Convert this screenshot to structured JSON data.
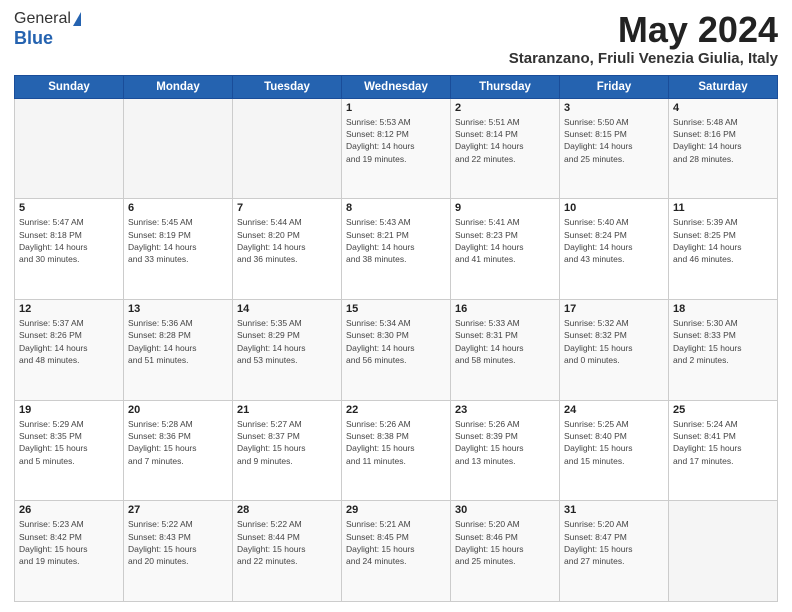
{
  "logo": {
    "general": "General",
    "blue": "Blue"
  },
  "title": "May 2024",
  "location": "Staranzano, Friuli Venezia Giulia, Italy",
  "weekdays": [
    "Sunday",
    "Monday",
    "Tuesday",
    "Wednesday",
    "Thursday",
    "Friday",
    "Saturday"
  ],
  "weeks": [
    [
      {
        "day": "",
        "info": ""
      },
      {
        "day": "",
        "info": ""
      },
      {
        "day": "",
        "info": ""
      },
      {
        "day": "1",
        "info": "Sunrise: 5:53 AM\nSunset: 8:12 PM\nDaylight: 14 hours\nand 19 minutes."
      },
      {
        "day": "2",
        "info": "Sunrise: 5:51 AM\nSunset: 8:14 PM\nDaylight: 14 hours\nand 22 minutes."
      },
      {
        "day": "3",
        "info": "Sunrise: 5:50 AM\nSunset: 8:15 PM\nDaylight: 14 hours\nand 25 minutes."
      },
      {
        "day": "4",
        "info": "Sunrise: 5:48 AM\nSunset: 8:16 PM\nDaylight: 14 hours\nand 28 minutes."
      }
    ],
    [
      {
        "day": "5",
        "info": "Sunrise: 5:47 AM\nSunset: 8:18 PM\nDaylight: 14 hours\nand 30 minutes."
      },
      {
        "day": "6",
        "info": "Sunrise: 5:45 AM\nSunset: 8:19 PM\nDaylight: 14 hours\nand 33 minutes."
      },
      {
        "day": "7",
        "info": "Sunrise: 5:44 AM\nSunset: 8:20 PM\nDaylight: 14 hours\nand 36 minutes."
      },
      {
        "day": "8",
        "info": "Sunrise: 5:43 AM\nSunset: 8:21 PM\nDaylight: 14 hours\nand 38 minutes."
      },
      {
        "day": "9",
        "info": "Sunrise: 5:41 AM\nSunset: 8:23 PM\nDaylight: 14 hours\nand 41 minutes."
      },
      {
        "day": "10",
        "info": "Sunrise: 5:40 AM\nSunset: 8:24 PM\nDaylight: 14 hours\nand 43 minutes."
      },
      {
        "day": "11",
        "info": "Sunrise: 5:39 AM\nSunset: 8:25 PM\nDaylight: 14 hours\nand 46 minutes."
      }
    ],
    [
      {
        "day": "12",
        "info": "Sunrise: 5:37 AM\nSunset: 8:26 PM\nDaylight: 14 hours\nand 48 minutes."
      },
      {
        "day": "13",
        "info": "Sunrise: 5:36 AM\nSunset: 8:28 PM\nDaylight: 14 hours\nand 51 minutes."
      },
      {
        "day": "14",
        "info": "Sunrise: 5:35 AM\nSunset: 8:29 PM\nDaylight: 14 hours\nand 53 minutes."
      },
      {
        "day": "15",
        "info": "Sunrise: 5:34 AM\nSunset: 8:30 PM\nDaylight: 14 hours\nand 56 minutes."
      },
      {
        "day": "16",
        "info": "Sunrise: 5:33 AM\nSunset: 8:31 PM\nDaylight: 14 hours\nand 58 minutes."
      },
      {
        "day": "17",
        "info": "Sunrise: 5:32 AM\nSunset: 8:32 PM\nDaylight: 15 hours\nand 0 minutes."
      },
      {
        "day": "18",
        "info": "Sunrise: 5:30 AM\nSunset: 8:33 PM\nDaylight: 15 hours\nand 2 minutes."
      }
    ],
    [
      {
        "day": "19",
        "info": "Sunrise: 5:29 AM\nSunset: 8:35 PM\nDaylight: 15 hours\nand 5 minutes."
      },
      {
        "day": "20",
        "info": "Sunrise: 5:28 AM\nSunset: 8:36 PM\nDaylight: 15 hours\nand 7 minutes."
      },
      {
        "day": "21",
        "info": "Sunrise: 5:27 AM\nSunset: 8:37 PM\nDaylight: 15 hours\nand 9 minutes."
      },
      {
        "day": "22",
        "info": "Sunrise: 5:26 AM\nSunset: 8:38 PM\nDaylight: 15 hours\nand 11 minutes."
      },
      {
        "day": "23",
        "info": "Sunrise: 5:26 AM\nSunset: 8:39 PM\nDaylight: 15 hours\nand 13 minutes."
      },
      {
        "day": "24",
        "info": "Sunrise: 5:25 AM\nSunset: 8:40 PM\nDaylight: 15 hours\nand 15 minutes."
      },
      {
        "day": "25",
        "info": "Sunrise: 5:24 AM\nSunset: 8:41 PM\nDaylight: 15 hours\nand 17 minutes."
      }
    ],
    [
      {
        "day": "26",
        "info": "Sunrise: 5:23 AM\nSunset: 8:42 PM\nDaylight: 15 hours\nand 19 minutes."
      },
      {
        "day": "27",
        "info": "Sunrise: 5:22 AM\nSunset: 8:43 PM\nDaylight: 15 hours\nand 20 minutes."
      },
      {
        "day": "28",
        "info": "Sunrise: 5:22 AM\nSunset: 8:44 PM\nDaylight: 15 hours\nand 22 minutes."
      },
      {
        "day": "29",
        "info": "Sunrise: 5:21 AM\nSunset: 8:45 PM\nDaylight: 15 hours\nand 24 minutes."
      },
      {
        "day": "30",
        "info": "Sunrise: 5:20 AM\nSunset: 8:46 PM\nDaylight: 15 hours\nand 25 minutes."
      },
      {
        "day": "31",
        "info": "Sunrise: 5:20 AM\nSunset: 8:47 PM\nDaylight: 15 hours\nand 27 minutes."
      },
      {
        "day": "",
        "info": ""
      }
    ]
  ]
}
